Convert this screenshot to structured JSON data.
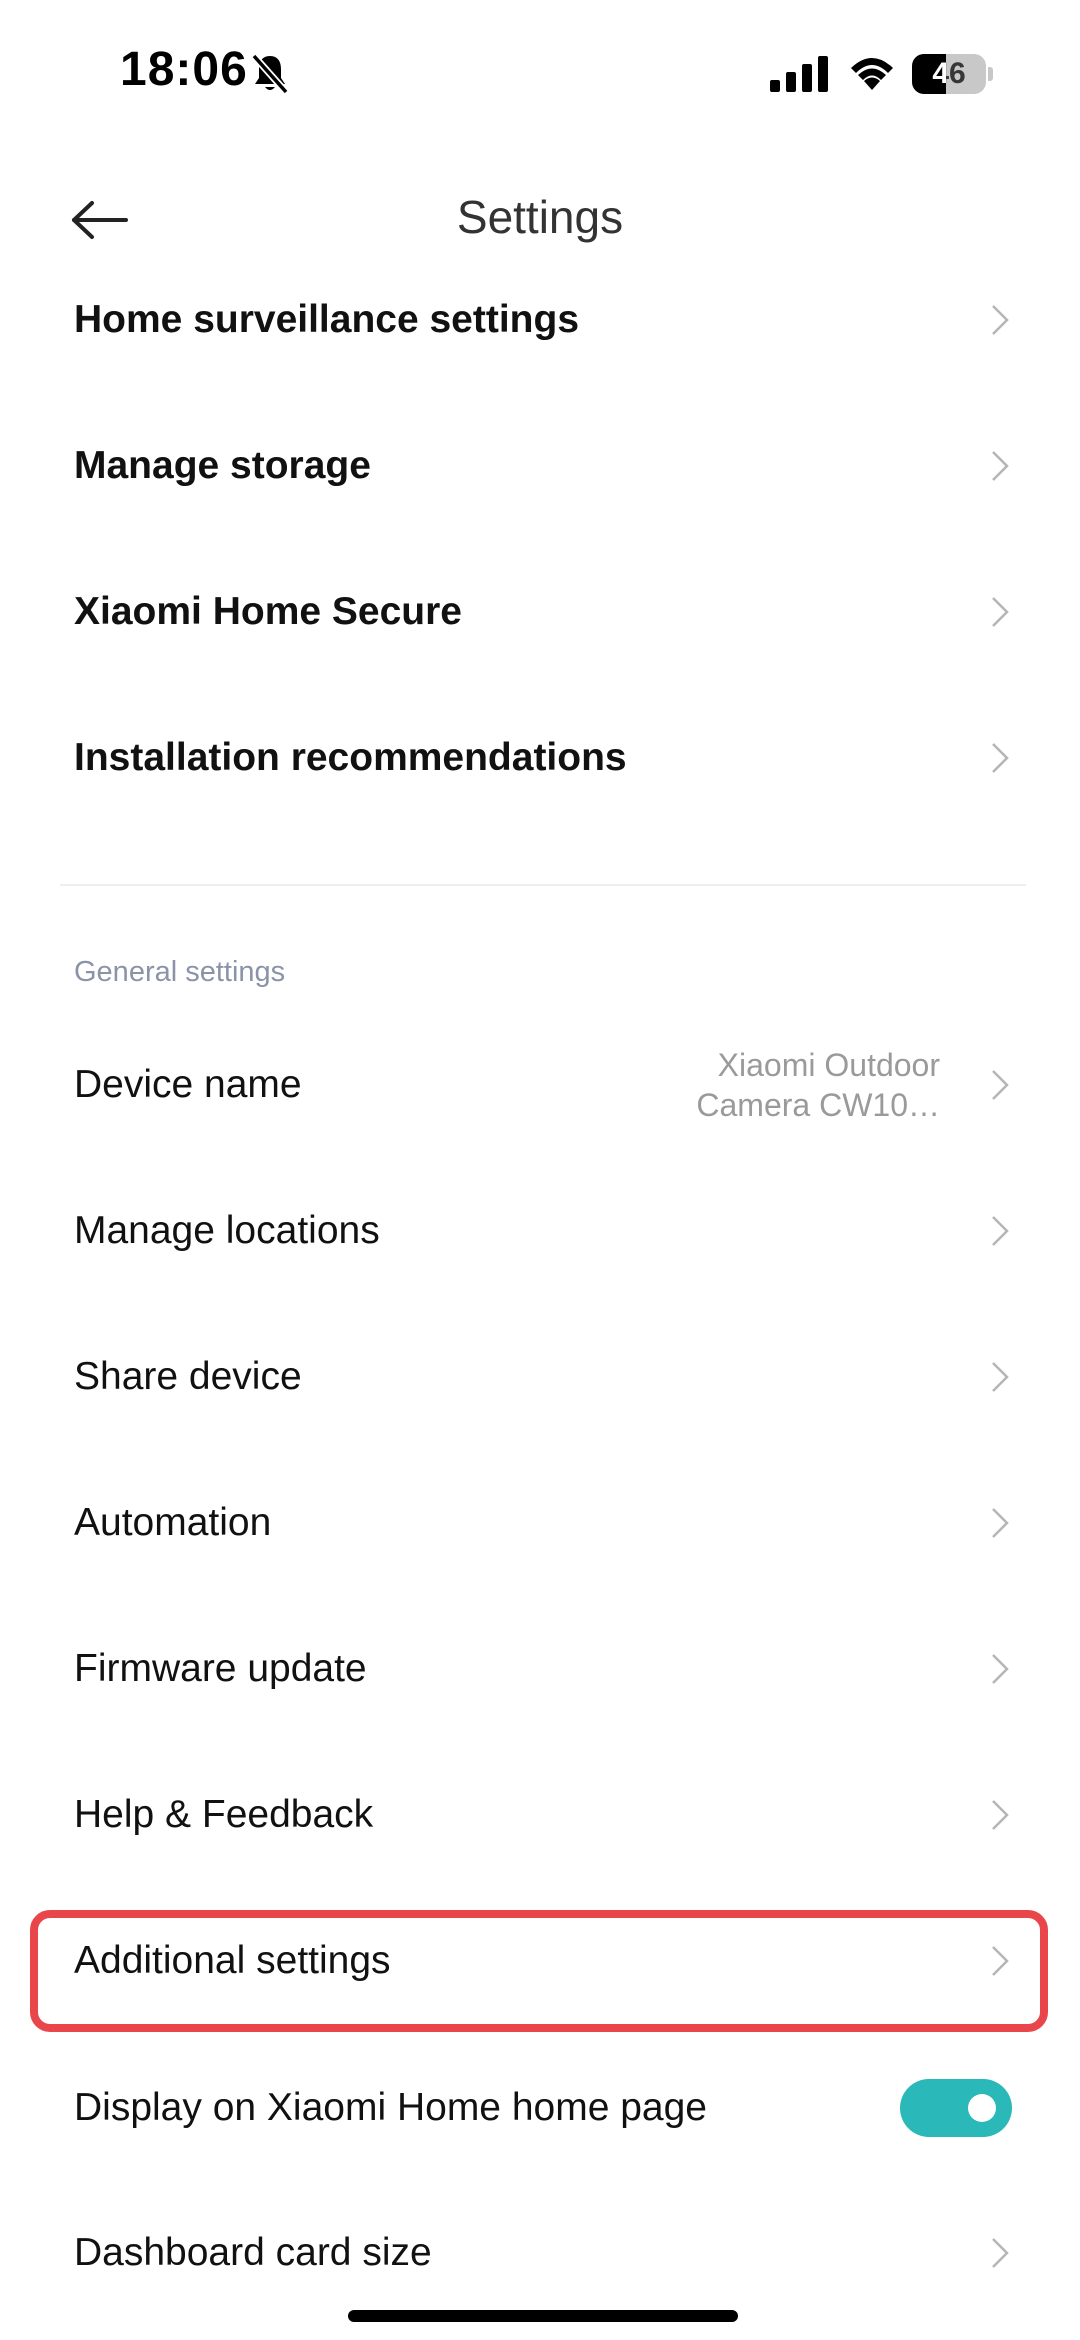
{
  "status_bar": {
    "time": "18:06",
    "battery_level": "46",
    "battery_fraction": 0.46,
    "icons": [
      "bell-slash-icon",
      "signal-icon",
      "wifi-icon",
      "battery-icon"
    ]
  },
  "header": {
    "title": "Settings",
    "back_icon": "arrow-left-icon"
  },
  "top_items": [
    {
      "label": "Home surveillance settings"
    },
    {
      "label": "Manage storage"
    },
    {
      "label": "Xiaomi Home Secure"
    },
    {
      "label": "Installation recommendations"
    }
  ],
  "general_section": {
    "header": "General settings",
    "items": [
      {
        "label": "Device name",
        "value_line1": "Xiaomi Outdoor",
        "value_line2": "Camera CW10…"
      },
      {
        "label": "Manage locations"
      },
      {
        "label": "Share device"
      },
      {
        "label": "Automation"
      },
      {
        "label": "Firmware update"
      },
      {
        "label": "Help & Feedback"
      },
      {
        "label": "Additional settings"
      },
      {
        "label": "Display on Xiaomi Home home page",
        "toggle_on": true
      },
      {
        "label": "Dashboard card size"
      }
    ]
  },
  "colors": {
    "highlight": "#e8464a",
    "toggle_on": "#2bb8b8",
    "section_header": "#8a93a8"
  }
}
